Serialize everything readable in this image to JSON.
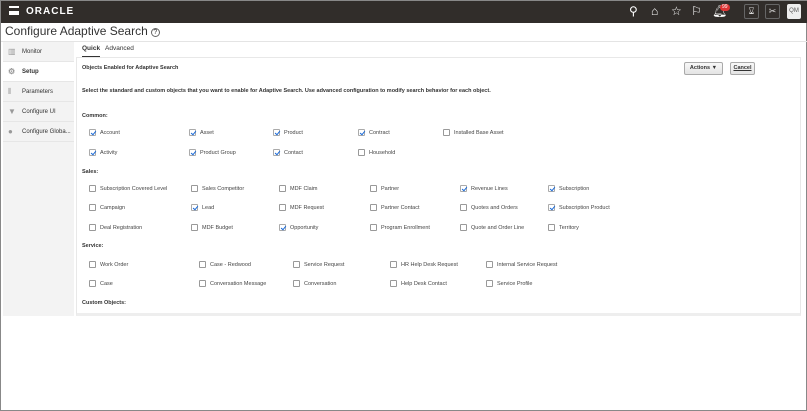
{
  "header": {
    "logo": "ORACLE",
    "notification_count": "99",
    "avatar": "QM"
  },
  "page_title": "Configure Adaptive Search",
  "help_icon": "?",
  "sidebar": {
    "items": [
      {
        "label": "Monitor",
        "icon": "▥"
      },
      {
        "label": "Setup",
        "icon": "⚙"
      },
      {
        "label": "Parameters",
        "icon": "⦀"
      },
      {
        "label": "Configure UI",
        "icon": "▼"
      },
      {
        "label": "Configure Globa...",
        "icon": "●"
      }
    ]
  },
  "tabs": [
    {
      "label": "Quick"
    },
    {
      "label": "Advanced"
    }
  ],
  "panel": {
    "heading": "Objects Enabled for Adaptive Search",
    "actions_label": "Actions ▼",
    "cancel_label": "Cancel",
    "description": "Select the standard and custom objects that you want to enable for Adaptive Search. Use advanced configuration to modify search behavior for each object."
  },
  "sections": [
    {
      "title": "Common:",
      "rows": [
        [
          {
            "label": "Account",
            "checked": true
          },
          {
            "label": "Asset",
            "checked": true
          },
          {
            "label": "Product",
            "checked": true
          },
          {
            "label": "Contract",
            "checked": true
          },
          {
            "label": "Installed Base Asset",
            "checked": false
          }
        ],
        [
          {
            "label": "Activity",
            "checked": true
          },
          {
            "label": "Product Group",
            "checked": true
          },
          {
            "label": "Contact",
            "checked": true
          },
          {
            "label": "Household",
            "checked": false
          }
        ]
      ]
    },
    {
      "title": "Sales:",
      "rows": [
        [
          {
            "label": "Subscription Covered Level",
            "checked": false
          },
          {
            "label": "Sales Competitor",
            "checked": false
          },
          {
            "label": "MDF Claim",
            "checked": false
          },
          {
            "label": "Partner",
            "checked": false
          },
          {
            "label": "Revenue Lines",
            "checked": true
          },
          {
            "label": "Subscription",
            "checked": true
          }
        ],
        [
          {
            "label": "Campaign",
            "checked": false
          },
          {
            "label": "Lead",
            "checked": true
          },
          {
            "label": "MDF Request",
            "checked": false
          },
          {
            "label": "Partner Contact",
            "checked": false
          },
          {
            "label": "Quotes and Orders",
            "checked": false
          },
          {
            "label": "Subscription Product",
            "checked": true
          }
        ],
        [
          {
            "label": "Deal Registration",
            "checked": false
          },
          {
            "label": "MDF Budget",
            "checked": false
          },
          {
            "label": "Opportunity",
            "checked": true
          },
          {
            "label": "Program Enrollment",
            "checked": false
          },
          {
            "label": "Quote and Order Line",
            "checked": false
          },
          {
            "label": "Territory",
            "checked": false
          }
        ]
      ]
    },
    {
      "title": "Service:",
      "rows": [
        [
          {
            "label": "Work Order",
            "checked": false
          },
          {
            "label": "Case - Redwood",
            "checked": false
          },
          {
            "label": "Service Request",
            "checked": false
          },
          {
            "label": "HR Help Desk Request",
            "checked": false
          },
          {
            "label": "Internal Service Request",
            "checked": false
          }
        ],
        [
          {
            "label": "Case",
            "checked": false
          },
          {
            "label": "Conversation Message",
            "checked": false
          },
          {
            "label": "Conversation",
            "checked": false
          },
          {
            "label": "Help Desk Contact",
            "checked": false
          },
          {
            "label": "Service Profile",
            "checked": false
          }
        ]
      ]
    },
    {
      "title": "Custom Objects:",
      "rows": []
    }
  ]
}
